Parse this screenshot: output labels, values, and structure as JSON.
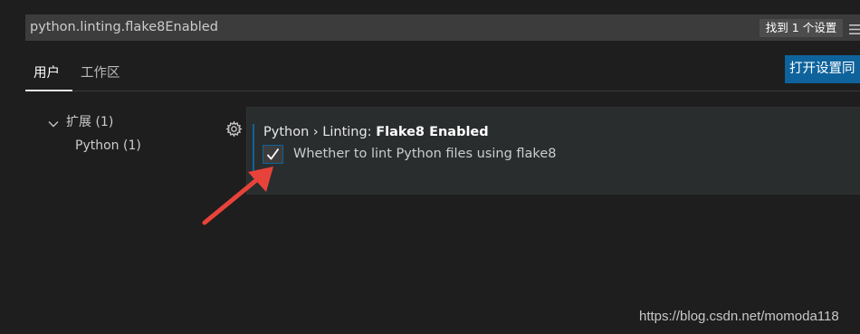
{
  "search": {
    "value": "python.linting.flake8Enabled",
    "result_count": "找到 1 个设置",
    "filter_icon": "filter-list-icon"
  },
  "tabs": [
    {
      "label": "用户",
      "active": true
    },
    {
      "label": "工作区",
      "active": false
    }
  ],
  "open_json_button": "打开设置同",
  "toc": {
    "section": "扩展 (1)",
    "items": [
      {
        "label": "Python (1)"
      }
    ]
  },
  "setting": {
    "category": "Python › Linting: ",
    "key": "Flake8 Enabled",
    "description": "Whether to lint Python files using flake8",
    "checked": true
  },
  "annotation_color": "#e8433a",
  "accent_color": "#0e639c",
  "watermark": "https://blog.csdn.net/momoda118"
}
